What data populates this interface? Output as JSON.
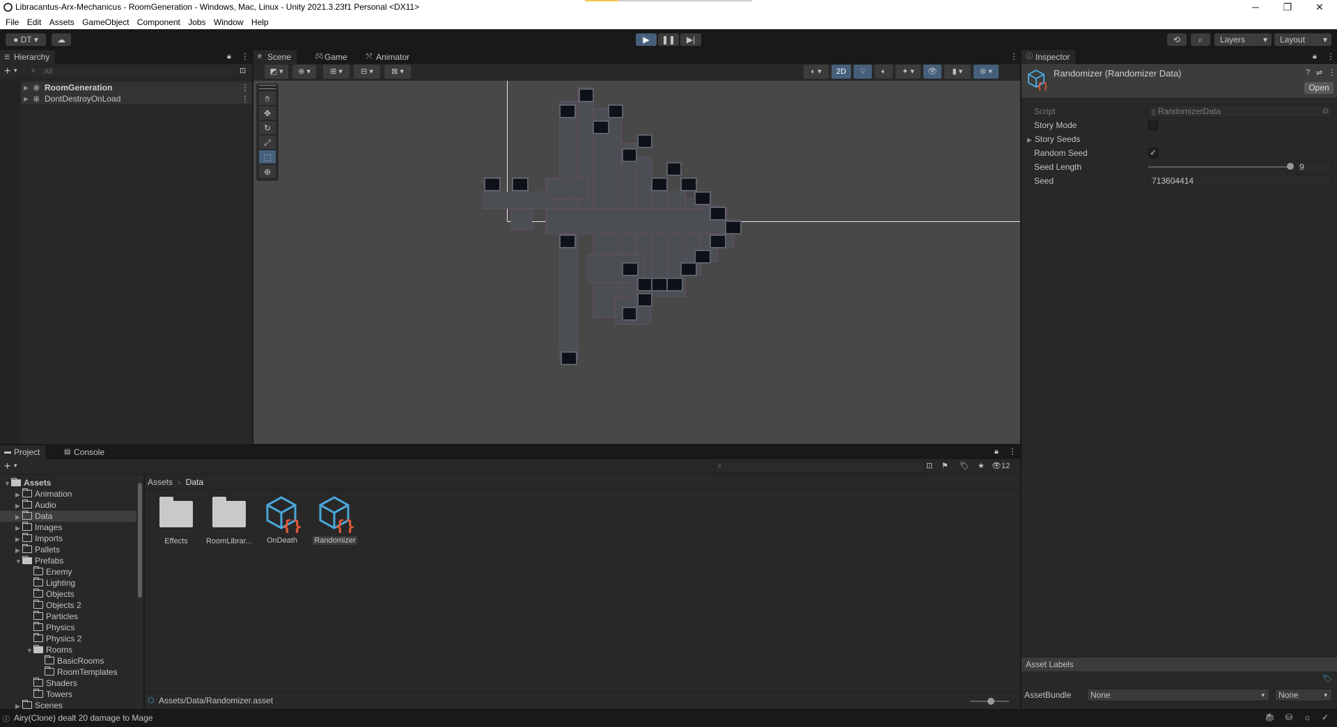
{
  "window": {
    "title": "Libracantus-Arx-Mechanicus - RoomGeneration - Windows, Mac, Linux - Unity 2021.3.23f1 Personal <DX11>",
    "minimize": "─",
    "maximize": "❐",
    "close": "✕"
  },
  "menu": [
    "File",
    "Edit",
    "Assets",
    "GameObject",
    "Component",
    "Jobs",
    "Window",
    "Help"
  ],
  "toolbar": {
    "account": "DT",
    "layers": "Layers",
    "layout": "Layout"
  },
  "hierarchy": {
    "tab": "Hierarchy",
    "search_placeholder": "All",
    "items": [
      {
        "label": "RoomGeneration"
      },
      {
        "label": "DontDestroyOnLoad"
      }
    ]
  },
  "scene": {
    "tabs": [
      "Scene",
      "Game",
      "Animator"
    ],
    "mode_2d": "2D"
  },
  "inspector": {
    "tab": "Inspector",
    "title": "Randomizer (Randomizer Data)",
    "open_button": "Open",
    "fields": {
      "script_label": "Script",
      "script_value": "RandomizerData",
      "story_mode_label": "Story Mode",
      "story_mode_checked": false,
      "story_seeds_label": "Story Seeds",
      "random_seed_label": "Random Seed",
      "random_seed_checked": true,
      "seed_length_label": "Seed Length",
      "seed_length_value": "9",
      "seed_length_fraction": 1.0,
      "seed_label": "Seed",
      "seed_value": "713604414"
    },
    "asset_labels": "Asset Labels",
    "assetbundle_label": "AssetBundle",
    "assetbundle_value": "None",
    "assetbundle_variant": "None"
  },
  "project": {
    "tabs": [
      "Project",
      "Console"
    ],
    "hidden_count": "12",
    "breadcrumb": [
      "Assets",
      "Data"
    ],
    "tree": [
      {
        "label": "Assets",
        "depth": 0,
        "open": true,
        "bold": true
      },
      {
        "label": "Animation",
        "depth": 1
      },
      {
        "label": "Audio",
        "depth": 1
      },
      {
        "label": "Data",
        "depth": 1,
        "selected": true
      },
      {
        "label": "Images",
        "depth": 1
      },
      {
        "label": "Imports",
        "depth": 1
      },
      {
        "label": "Pallets",
        "depth": 1
      },
      {
        "label": "Prefabs",
        "depth": 1,
        "open": true
      },
      {
        "label": "Enemy",
        "depth": 2
      },
      {
        "label": "Lighting",
        "depth": 2
      },
      {
        "label": "Objects",
        "depth": 2
      },
      {
        "label": "Objects 2",
        "depth": 2
      },
      {
        "label": "Particles",
        "depth": 2
      },
      {
        "label": "Physics",
        "depth": 2
      },
      {
        "label": "Physics 2",
        "depth": 2
      },
      {
        "label": "Rooms",
        "depth": 2,
        "open": true
      },
      {
        "label": "BasicRooms",
        "depth": 3
      },
      {
        "label": "RoomTemplates",
        "depth": 3
      },
      {
        "label": "Shaders",
        "depth": 2
      },
      {
        "label": "Towers",
        "depth": 2
      },
      {
        "label": "Scenes",
        "depth": 1
      }
    ],
    "assets": [
      {
        "label": "Effects",
        "kind": "folder"
      },
      {
        "label": "RoomLibrar...",
        "kind": "folder"
      },
      {
        "label": "OnDeath",
        "kind": "scriptable"
      },
      {
        "label": "Randomizer",
        "kind": "scriptable",
        "selected": true
      }
    ],
    "path": "Assets/Data/Randomizer.asset"
  },
  "status": {
    "message": "Airy(Clone) dealt 20 damage to Mage"
  },
  "colors": {
    "accent": "#46607c",
    "selection": "#2c5d87",
    "script_icon_blue": "#4aa6d8",
    "script_icon_orange": "#e0573a"
  }
}
